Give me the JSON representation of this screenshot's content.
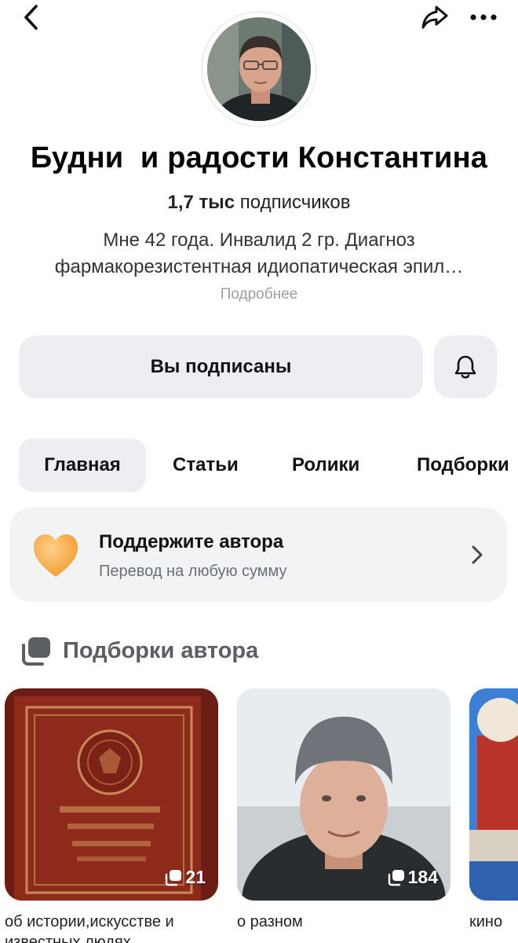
{
  "channel": {
    "title": "Будни  и радости Константина",
    "subscribers_count": "1,7 тыс",
    "subscribers_label": " подписчиков",
    "description": "Мне 42 года. Инвалид 2 гр. Диагноз фармакорезистентная идиопатическая эпил…",
    "more_link": "Подробнее"
  },
  "actions": {
    "subscribed_label": "Вы подписаны"
  },
  "tabs": [
    {
      "label": "Главная",
      "active": true
    },
    {
      "label": "Статьи",
      "active": false
    },
    {
      "label": "Ролики",
      "active": false
    },
    {
      "label": "Подборки",
      "active": false
    }
  ],
  "support": {
    "title": "Поддержите автора",
    "subtitle": "Перевод на любую сумму"
  },
  "collections": {
    "section_title": "Подборки автора",
    "items": [
      {
        "label": "об истории,искусстве и известных людях",
        "count": "21"
      },
      {
        "label": "о разном",
        "count": "184"
      },
      {
        "label": "кино",
        "count": ""
      }
    ]
  },
  "icons": [
    "back-icon",
    "share-icon",
    "more-icon",
    "bell-icon",
    "heart-icon",
    "chevron-right-icon",
    "collection-icon"
  ],
  "colors": {
    "button_bg": "#eceef2",
    "card_bg": "#f2f3f5",
    "muted_text": "#9a9ea5",
    "heart": "#f7a23b"
  }
}
